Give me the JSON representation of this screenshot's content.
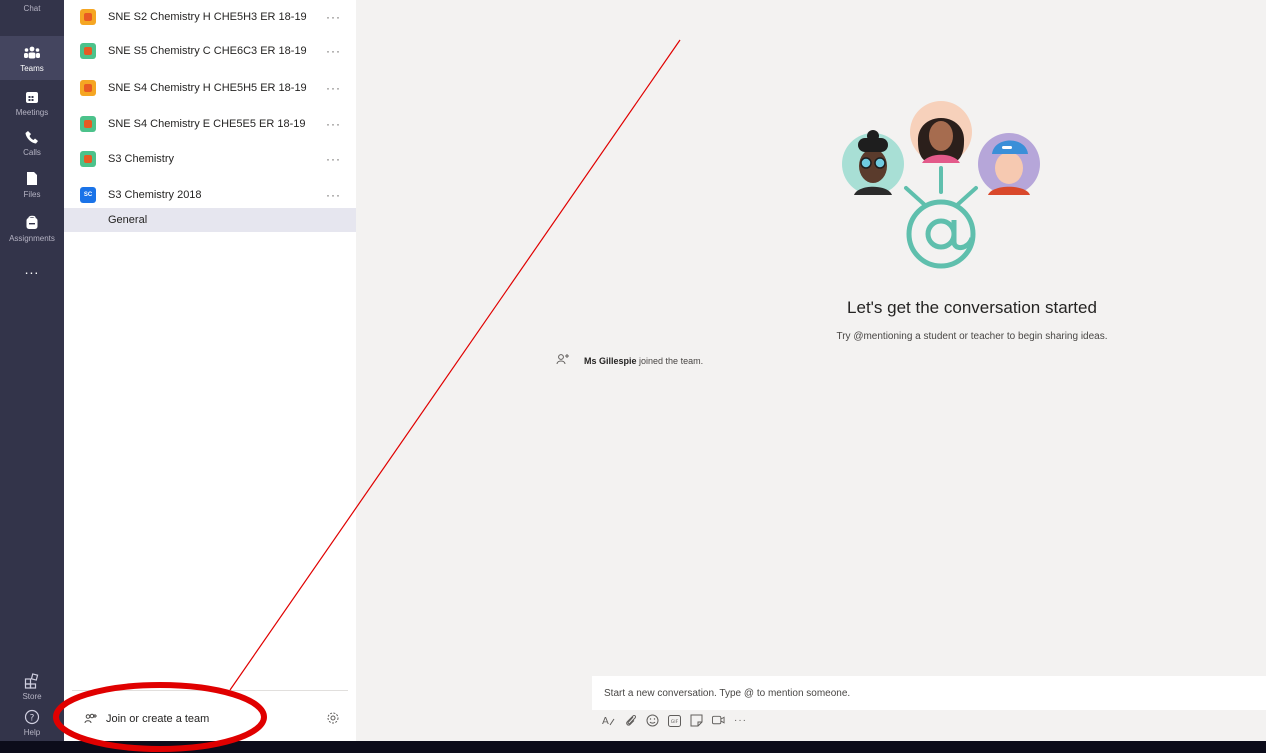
{
  "rail": {
    "items": [
      {
        "label": "Chat",
        "icon": "chat-icon"
      },
      {
        "label": "Teams",
        "icon": "teams-icon"
      },
      {
        "label": "Meetings",
        "icon": "calendar-icon"
      },
      {
        "label": "Calls",
        "icon": "phone-icon"
      },
      {
        "label": "Files",
        "icon": "file-icon"
      },
      {
        "label": "Assignments",
        "icon": "assignments-icon"
      },
      {
        "label": "Store",
        "icon": "store-icon"
      },
      {
        "label": "Help",
        "icon": "help-icon"
      }
    ],
    "more": "..."
  },
  "teams": {
    "items": [
      {
        "name": "SNE S2 Chemistry H CHE5H3 ER 18-19",
        "more": "···"
      },
      {
        "name": "SNE S5 Chemistry C CHE6C3 ER 18-19",
        "more": "···"
      },
      {
        "name": "SNE S4 Chemistry H CHE5H5 ER 18-19",
        "more": "···"
      },
      {
        "name": "SNE S4 Chemistry E CHE5E5 ER 18-19",
        "more": "···"
      },
      {
        "name": "S3 Chemistry",
        "more": "···"
      },
      {
        "name": "S3 Chemistry 2018",
        "more": "···",
        "avatar_text": "SC"
      }
    ],
    "channel": "General",
    "join_label": "Join or create a team"
  },
  "conversation": {
    "title": "Let's get the conversation started",
    "subtitle": "Try @mentioning a student or teacher to begin sharing ideas.",
    "joined_user": "Ms Gillespie",
    "joined_text": " joined the team.",
    "compose_placeholder": "Start a new conversation. Type @ to mention someone.",
    "toolbar_more": "···"
  },
  "colors": {
    "rail": "#33344a",
    "accent": "#5b5fc7",
    "annotation": "#e00000",
    "mention_teal": "#5fbfad"
  }
}
